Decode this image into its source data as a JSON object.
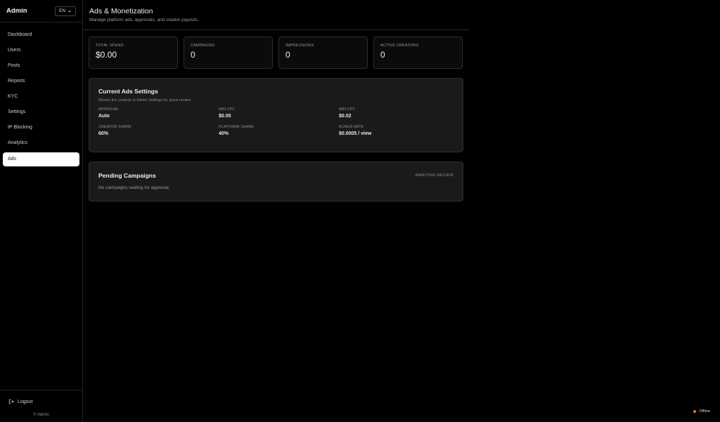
{
  "sidebar": {
    "brand": "Admin",
    "lang": "EN",
    "items": [
      {
        "label": "Dashboard"
      },
      {
        "label": "Users"
      },
      {
        "label": "Posts"
      },
      {
        "label": "Reports"
      },
      {
        "label": "KYC"
      },
      {
        "label": "Settings"
      },
      {
        "label": "IP Blocking"
      },
      {
        "label": "Analytics"
      },
      {
        "label": "Ads",
        "active": true
      }
    ],
    "logout": "Logout",
    "copyright": "© Admin"
  },
  "header": {
    "title": "Ads & Monetization",
    "subtitle": "Manage platform ads, approvals, and creator payouts."
  },
  "stats": [
    {
      "label": "TOTAL SPEND",
      "value": "$0.00"
    },
    {
      "label": "CAMPAIGNS",
      "value": "0"
    },
    {
      "label": "IMPRESSIONS",
      "value": "0"
    },
    {
      "label": "ACTIVE CREATORS",
      "value": "0"
    }
  ],
  "settings": {
    "title": "Current Ads Settings",
    "subtitle": "Mirrors the controls in Admin Settings for quick review.",
    "fields": [
      {
        "label": "APPROVAL",
        "value": "Auto"
      },
      {
        "label": "MIN CPC",
        "value": "$0.05"
      },
      {
        "label": "MIN CPV",
        "value": "$0.02"
      },
      {
        "label": "CREATOR SHARE",
        "value": "60%"
      },
      {
        "label": "PLATFORM SHARE",
        "value": "40%"
      },
      {
        "label": "BONUS RATE",
        "value": "$0.0005 / view"
      }
    ]
  },
  "pending": {
    "title": "Pending Campaigns",
    "badge": "AWAITING REVIEW",
    "empty": "No campaigns waiting for approval."
  },
  "status": {
    "label": "Offline",
    "color": "#e07a2f"
  }
}
